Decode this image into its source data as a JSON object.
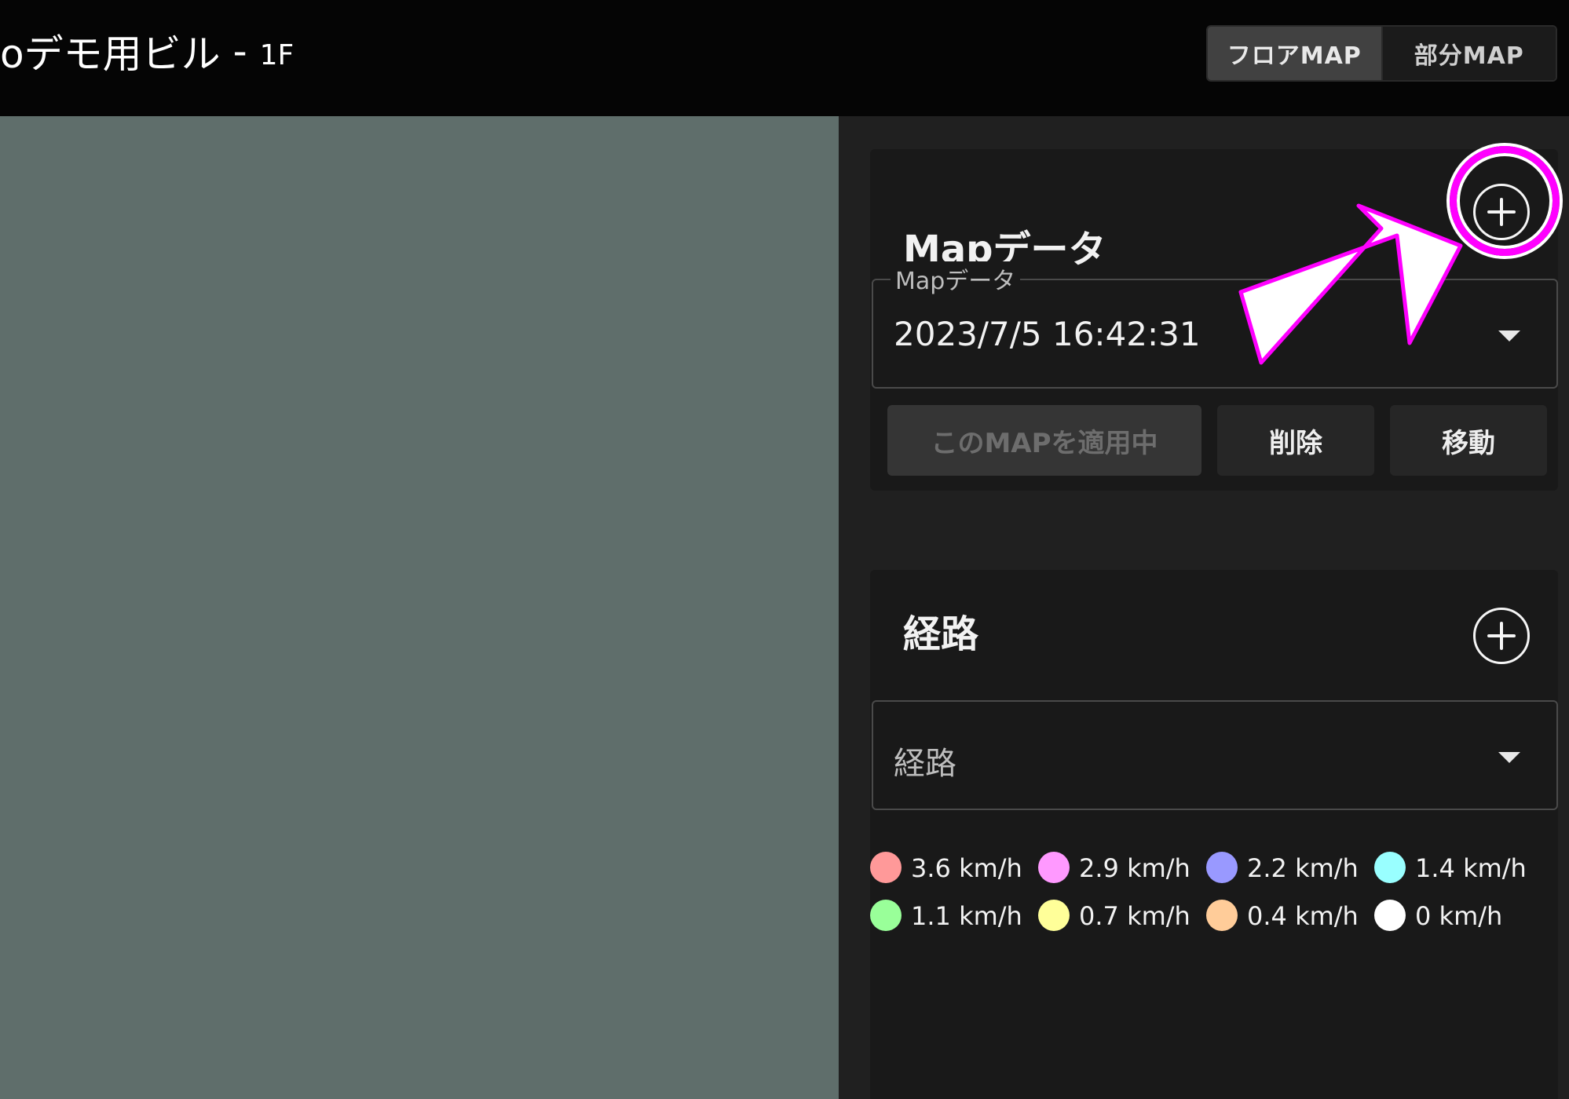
{
  "header": {
    "title": "oデモ用ビル",
    "separator": "-",
    "floor": "1F",
    "toggle": {
      "floor_map": "フロアMAP",
      "partial_map": "部分MAP"
    }
  },
  "map_section": {
    "title": "Mapデータ",
    "select_label": "Mapデータ",
    "selected_value": "2023/7/5 16:42:31",
    "buttons": {
      "apply": "このMAPを適用中",
      "delete": "削除",
      "move": "移動"
    }
  },
  "route_section": {
    "title": "経路",
    "select_placeholder": "経路"
  },
  "speed_legend": [
    {
      "label": "3.6 km/h",
      "color": "#ff9999"
    },
    {
      "label": "2.9 km/h",
      "color": "#ff99ff"
    },
    {
      "label": "2.2 km/h",
      "color": "#9999ff"
    },
    {
      "label": "1.4 km/h",
      "color": "#99ffff"
    },
    {
      "label": "1.1 km/h",
      "color": "#99ff99"
    },
    {
      "label": "0.7 km/h",
      "color": "#ffff99"
    },
    {
      "label": "0.4 km/h",
      "color": "#ffcc99"
    },
    {
      "label": "0 km/h",
      "color": "#ffffff"
    }
  ],
  "colors": {
    "highlight": "#ff00ff",
    "map_canvas": "#5f6e6b",
    "header_bg": "#050505"
  }
}
